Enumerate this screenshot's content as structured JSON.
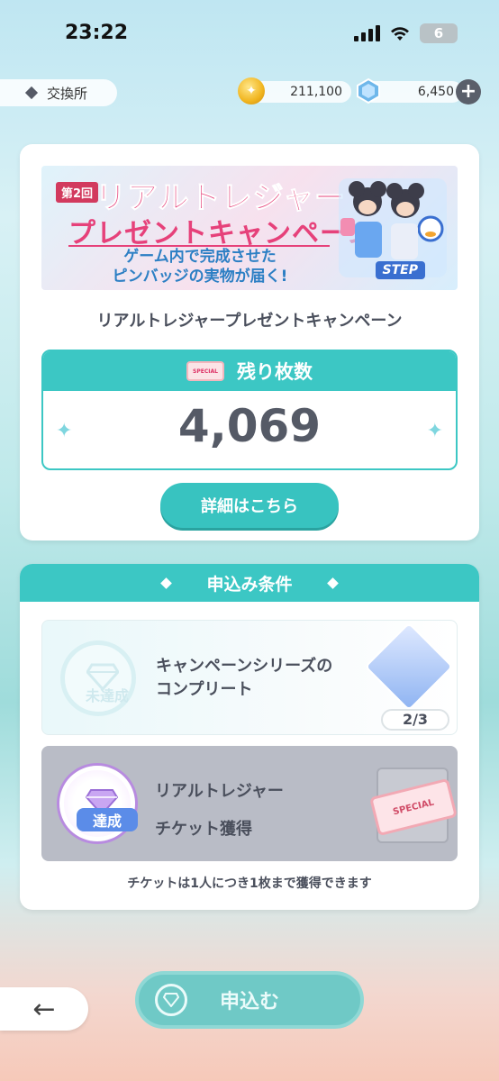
{
  "status_bar": {
    "time": "23:22",
    "battery": "6"
  },
  "header": {
    "shop_label": "交換所",
    "coins": "211,100",
    "gems": "6,450",
    "plus": "+"
  },
  "banner": {
    "badge": "第2回",
    "line1": "リアルトレジャー",
    "line2": "プレゼントキャンペーン",
    "line3": "ゲーム内で完成させた\nピンバッジの実物が届く!",
    "logo": "STEP"
  },
  "campaign": {
    "title": "リアルトレジャープレゼントキャンペーン",
    "remaining_label": "残り枚数",
    "remaining_value": "4,069",
    "detail_button": "詳細はこちら"
  },
  "conditions": {
    "header": "申込み条件",
    "items": [
      {
        "status": "未達成",
        "text_line1": "キャンペーンシリーズの",
        "text_line2": "コンプリート",
        "progress": "2/3"
      },
      {
        "status": "達成",
        "text_line1": "リアルトレジャー",
        "text_line2": "チケット獲得",
        "ticket_label": "SPECIAL"
      }
    ],
    "note": "チケットは1人につき1枚まで獲得できます"
  },
  "footer": {
    "back_icon": "←",
    "apply_button": "申込む"
  },
  "colors": {
    "accent": "#3cc7c4",
    "pink": "#e6417a",
    "text": "#4a4f5c"
  }
}
